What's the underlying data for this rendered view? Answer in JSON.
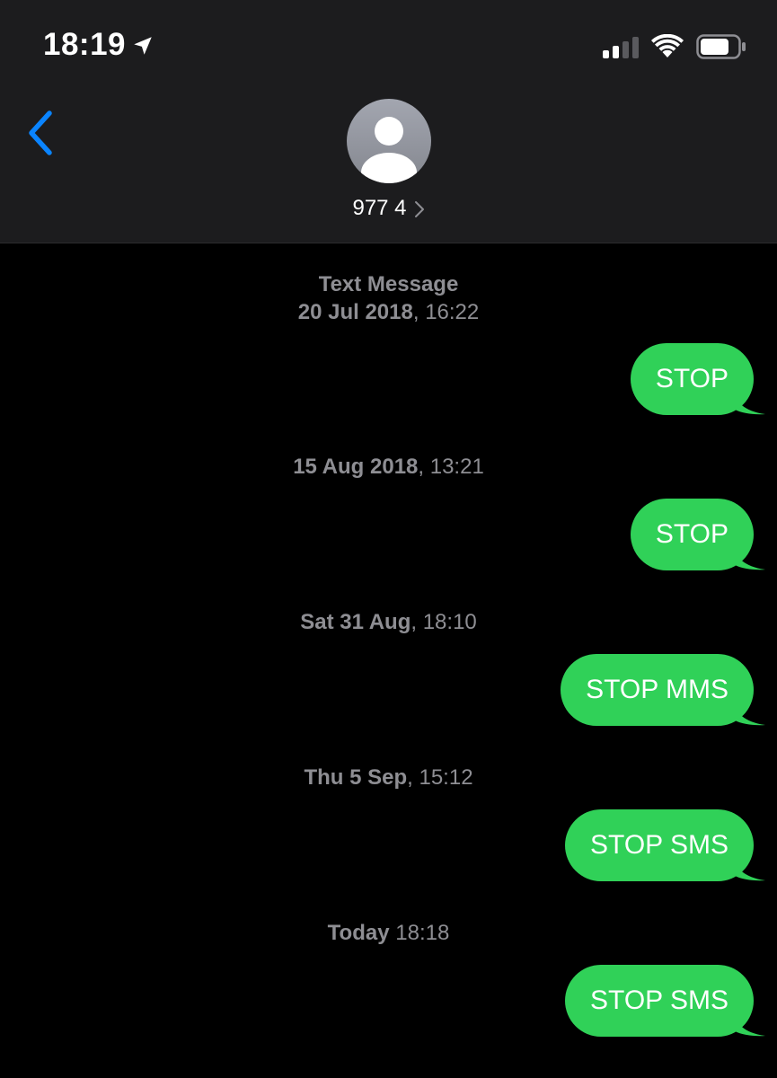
{
  "status_bar": {
    "time": "18:19",
    "location_icon": "location-arrow-icon",
    "signal_icon": "cellular-signal-icon",
    "wifi_icon": "wifi-icon",
    "battery_icon": "battery-icon"
  },
  "nav": {
    "back_icon": "chevron-left-icon",
    "contact_name": "977 4",
    "avatar_icon": "person-placeholder-icon",
    "detail_icon": "chevron-right-icon"
  },
  "colors": {
    "accent": "#0a84ff",
    "bubble": "#30d158",
    "header_bg": "#1c1c1e",
    "timestamp_text": "#8e8e93",
    "background": "#000000"
  },
  "conversation": {
    "service_label": "Text Message",
    "entries": [
      {
        "date": "20 Jul 2018",
        "time": "16:22",
        "message": "STOP"
      },
      {
        "date": "15 Aug 2018",
        "time": "13:21",
        "message": "STOP"
      },
      {
        "date": "Sat 31 Aug",
        "time": "18:10",
        "message": "STOP MMS"
      },
      {
        "date": "Thu 5 Sep",
        "time": "15:12",
        "message": "STOP SMS"
      },
      {
        "date": "Today",
        "time": "18:18",
        "message": "STOP SMS"
      }
    ]
  }
}
